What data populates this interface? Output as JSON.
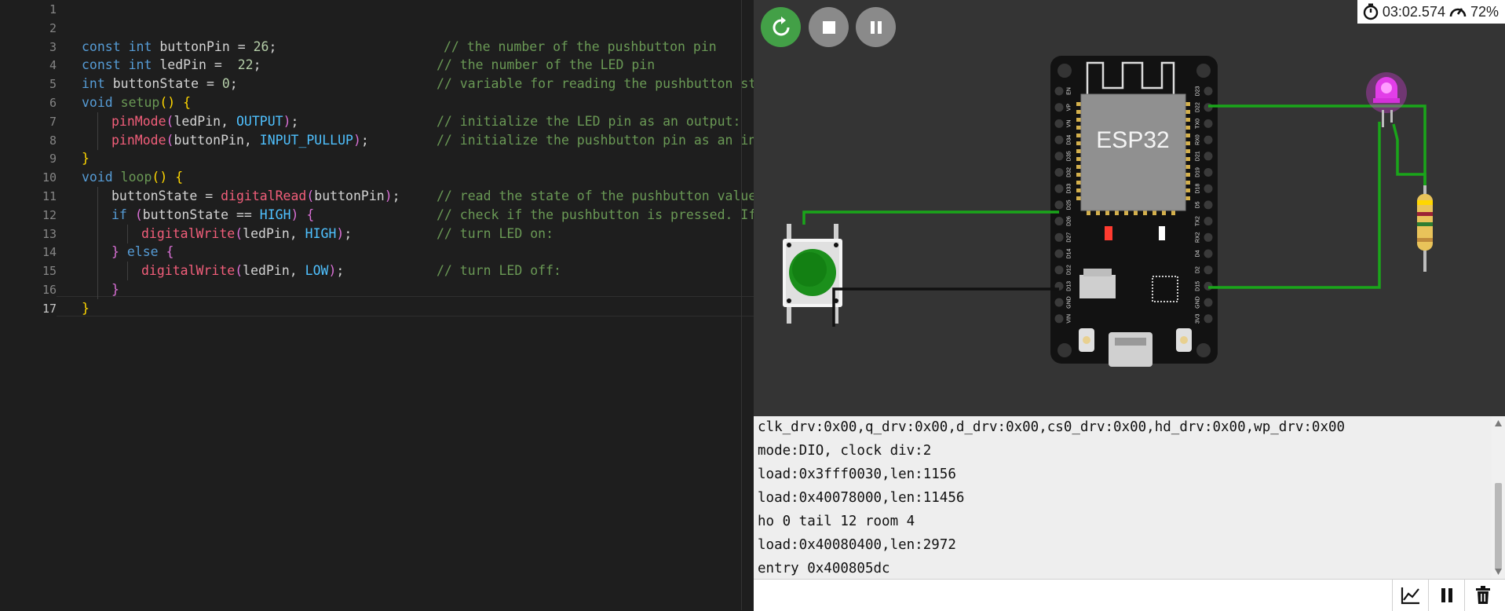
{
  "editor": {
    "lines": [
      {
        "n": "1"
      },
      {
        "n": "2"
      },
      {
        "n": "3",
        "parts": [
          [
            "kw",
            "const "
          ],
          [
            "kw",
            "int "
          ],
          [
            "var",
            "buttonPin = "
          ],
          [
            "num",
            "26"
          ],
          [
            "var",
            ";"
          ]
        ],
        "comment": "// the number of the pushbutton pin",
        "ci": 565
      },
      {
        "n": "4",
        "parts": [
          [
            "kw",
            "const "
          ],
          [
            "kw",
            "int "
          ],
          [
            "var",
            "ledPin =  "
          ],
          [
            "num",
            "22"
          ],
          [
            "var",
            ";"
          ]
        ],
        "comment": "// the number of the LED pin",
        "ci": 556
      },
      {
        "n": "5",
        "parts": [
          [
            "kw",
            "int "
          ],
          [
            "var",
            "buttonState = "
          ],
          [
            "num",
            "0"
          ],
          [
            "var",
            ";"
          ]
        ],
        "comment": "// variable for reading the pushbutton status",
        "ci": 556
      },
      {
        "n": "6",
        "parts": [
          [
            "kw",
            "void "
          ],
          [
            "cmt",
            "setup"
          ],
          [
            "br1",
            "() {"
          ]
        ]
      },
      {
        "n": "7",
        "indent": 1,
        "parts": [
          [
            "fnr",
            "pinMode"
          ],
          [
            "br2",
            "("
          ],
          [
            "var",
            "ledPin, "
          ],
          [
            "cst",
            "OUTPUT"
          ],
          [
            "br2",
            ")"
          ],
          [
            "var",
            ";"
          ]
        ],
        "comment": "// initialize the LED pin as an output:",
        "ci": 556
      },
      {
        "n": "8",
        "indent": 1,
        "parts": [
          [
            "fnr",
            "pinMode"
          ],
          [
            "br2",
            "("
          ],
          [
            "var",
            "buttonPin, "
          ],
          [
            "cst",
            "INPUT_PULLUP"
          ],
          [
            "br2",
            ")"
          ],
          [
            "var",
            ";"
          ]
        ],
        "comment": "// initialize the pushbutton pin as an input:",
        "ci": 556
      },
      {
        "n": "9",
        "parts": [
          [
            "br1",
            "}"
          ]
        ]
      },
      {
        "n": "10",
        "parts": [
          [
            "kw",
            "void "
          ],
          [
            "cmt",
            "loop"
          ],
          [
            "br1",
            "() {"
          ]
        ]
      },
      {
        "n": "11",
        "indent": 1,
        "parts": [
          [
            "var",
            "buttonState = "
          ],
          [
            "fnr",
            "digitalRead"
          ],
          [
            "br2",
            "("
          ],
          [
            "var",
            "buttonPin"
          ],
          [
            "br2",
            ")"
          ],
          [
            "var",
            ";"
          ]
        ],
        "comment": "// read the state of the pushbutton value:",
        "ci": 556
      },
      {
        "n": "12",
        "indent": 1,
        "parts": [
          [
            "kw",
            "if "
          ],
          [
            "br2",
            "("
          ],
          [
            "var",
            "buttonState == "
          ],
          [
            "cst",
            "HIGH"
          ],
          [
            "br2",
            ") {"
          ]
        ],
        "comment": "// check if the pushbutton is pressed. If it is, the buttonState is HIGH:",
        "ci": 556
      },
      {
        "n": "13",
        "indent": 2,
        "parts": [
          [
            "fnr",
            "digitalWrite"
          ],
          [
            "br2",
            "("
          ],
          [
            "var",
            "ledPin, "
          ],
          [
            "cst",
            "HIGH"
          ],
          [
            "br2",
            ")"
          ],
          [
            "var",
            ";"
          ]
        ],
        "comment": "// turn LED on:",
        "ci": 556
      },
      {
        "n": "14",
        "indent": 1,
        "parts": [
          [
            "br2",
            "} "
          ],
          [
            "kw",
            "else "
          ],
          [
            "br2",
            "{"
          ]
        ]
      },
      {
        "n": "15",
        "indent": 2,
        "parts": [
          [
            "fnr",
            "digitalWrite"
          ],
          [
            "br2",
            "("
          ],
          [
            "var",
            "ledPin, "
          ],
          [
            "cst",
            "LOW"
          ],
          [
            "br2",
            ")"
          ],
          [
            "var",
            ";"
          ]
        ],
        "comment": "// turn LED off:",
        "ci": 556
      },
      {
        "n": "16",
        "indent": 1,
        "parts": [
          [
            "br2",
            "}"
          ]
        ]
      },
      {
        "n": "17",
        "parts": [
          [
            "br1",
            "}"
          ]
        ]
      }
    ]
  },
  "toolbar": {
    "restart_icon": "restart-icon",
    "stop_icon": "stop-icon",
    "pause_icon": "pause-icon",
    "restart_color": "#43a047",
    "button_color": "#8a8a8a"
  },
  "status": {
    "time": "03:02.574",
    "speed": "72%"
  },
  "board": {
    "label": "ESP32",
    "left_pins": [
      "EN",
      "VP",
      "VN",
      "D34",
      "D35",
      "D32",
      "D33",
      "D25",
      "D26",
      "D27",
      "D14",
      "D12",
      "D13",
      "GND",
      "VIN"
    ],
    "right_pins": [
      "D23",
      "D22",
      "TX0",
      "RX0",
      "D21",
      "D19",
      "D18",
      "D5",
      "TX2",
      "RX2",
      "D4",
      "D2",
      "D15",
      "GND",
      "3V3"
    ]
  },
  "colors": {
    "wire_green": "#1aa51a",
    "wire_black": "#111111",
    "led_magenta": "#e23ee8",
    "button_green": "#1b8f1b"
  },
  "serial": {
    "lines": [
      "clk_drv:0x00,q_drv:0x00,d_drv:0x00,cs0_drv:0x00,hd_drv:0x00,wp_drv:0x00",
      "mode:DIO, clock div:2",
      "load:0x3fff0030,len:1156",
      "load:0x40078000,len:11456",
      "ho 0 tail 12 room 4",
      "load:0x40080400,len:2972",
      "entry 0x400805dc"
    ],
    "input_placeholder": "",
    "plotter_icon": "chart-icon",
    "pause_icon": "pause-icon",
    "clear_icon": "trash-icon"
  }
}
